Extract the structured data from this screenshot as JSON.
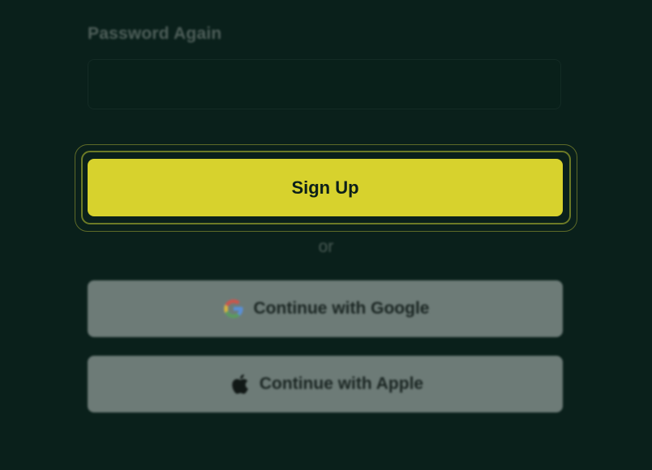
{
  "form": {
    "password_again_label": "Password Again",
    "password_again_value": ""
  },
  "actions": {
    "signup_label": "Sign Up",
    "or_label": "or",
    "google_label": "Continue with Google",
    "apple_label": "Continue with Apple"
  },
  "icons": {
    "google": "google-logo-icon",
    "apple": "apple-logo-icon"
  },
  "colors": {
    "background": "#0a201b",
    "primary_button": "#d7d22d",
    "primary_text": "#0c1f1a",
    "social_button": "#6d7b77",
    "focus_ring": "#6c7a26"
  }
}
